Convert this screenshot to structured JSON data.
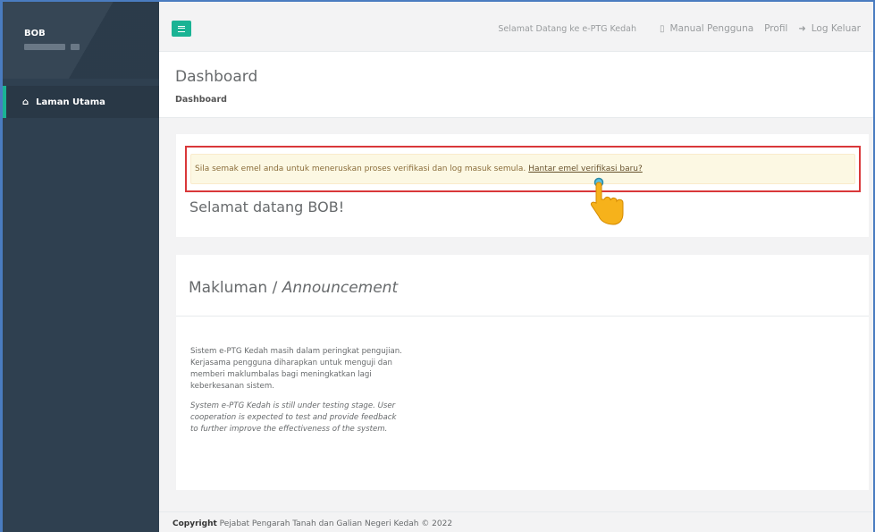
{
  "sidebar": {
    "user_name": "BOB",
    "nav_items": [
      {
        "label": "Laman Utama",
        "icon": "home-icon",
        "active": true
      }
    ],
    "accent_color": "#1ab394",
    "background_color": "#2f4050"
  },
  "topbar": {
    "welcome_text": "Selamat Datang ke e-PTG Kedah",
    "manual_label": "Manual Pengguna",
    "profile_label": "Profil",
    "logout_label": "Log Keluar"
  },
  "page": {
    "title": "Dashboard",
    "breadcrumb": "Dashboard"
  },
  "alert": {
    "message": "Sila semak emel anda untuk meneruskan proses verifikasi dan log masuk semula.",
    "link_text": "Hantar emel verifikasi baru?",
    "highlight_color": "#d9383a"
  },
  "welcome": {
    "text": "Selamat datang BOB!"
  },
  "announcement": {
    "title_ms": "Makluman / ",
    "title_en": "Announcement",
    "body_ms": "Sistem e-PTG Kedah masih dalam peringkat pengujian. Kerjasama pengguna diharapkan untuk menguji dan memberi maklumbalas bagi meningkatkan lagi keberkesanan sistem.",
    "body_en": "System e-PTG Kedah is still under testing stage. User cooperation is expected to test and provide feedback to further improve the effectiveness of the system."
  },
  "footer": {
    "copyright_label": "Copyright",
    "text": "Pejabat Pengarah Tanah dan Galian Negeri Kedah © 2022"
  }
}
